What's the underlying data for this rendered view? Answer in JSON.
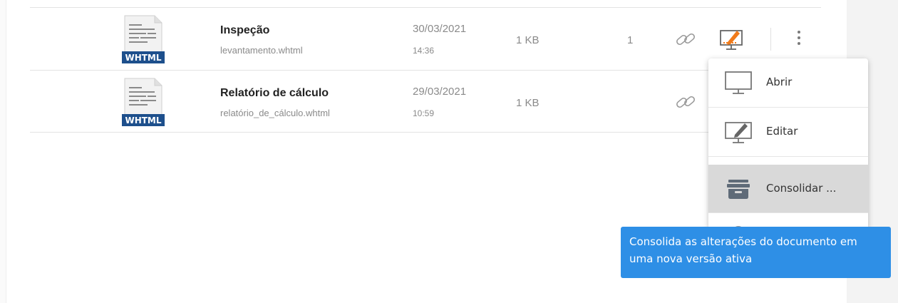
{
  "files": [
    {
      "name": "Inspeção",
      "filename": "levantamento.whtml",
      "date": "30/03/2021",
      "time": "14:36",
      "size": "1 KB",
      "count": "1",
      "badge": "WHTML"
    },
    {
      "name": "Relatório de cálculo",
      "filename": "relatório_de_cálculo.whtml",
      "date": "29/03/2021",
      "time": "10:59",
      "size": "1 KB",
      "badge": "WHTML"
    }
  ],
  "menu": {
    "items": [
      {
        "label": "Abrir",
        "icon": "monitor-icon"
      },
      {
        "label": "Editar",
        "icon": "monitor-edit-icon"
      },
      {
        "label": "Consolidar ...",
        "icon": "archive-box-icon",
        "state": "hovered"
      },
      {
        "label": "",
        "icon": "cut-off-item-icon"
      }
    ]
  },
  "tooltip": {
    "text": "Consolida as alterações do documento em uma nova versão ativa"
  },
  "colors": {
    "accent_orange": "#f07a1a",
    "tooltip_blue": "#2e8fe6",
    "badge_blue": "#1d4f8c",
    "icon_gray": "#7a7a7a"
  }
}
